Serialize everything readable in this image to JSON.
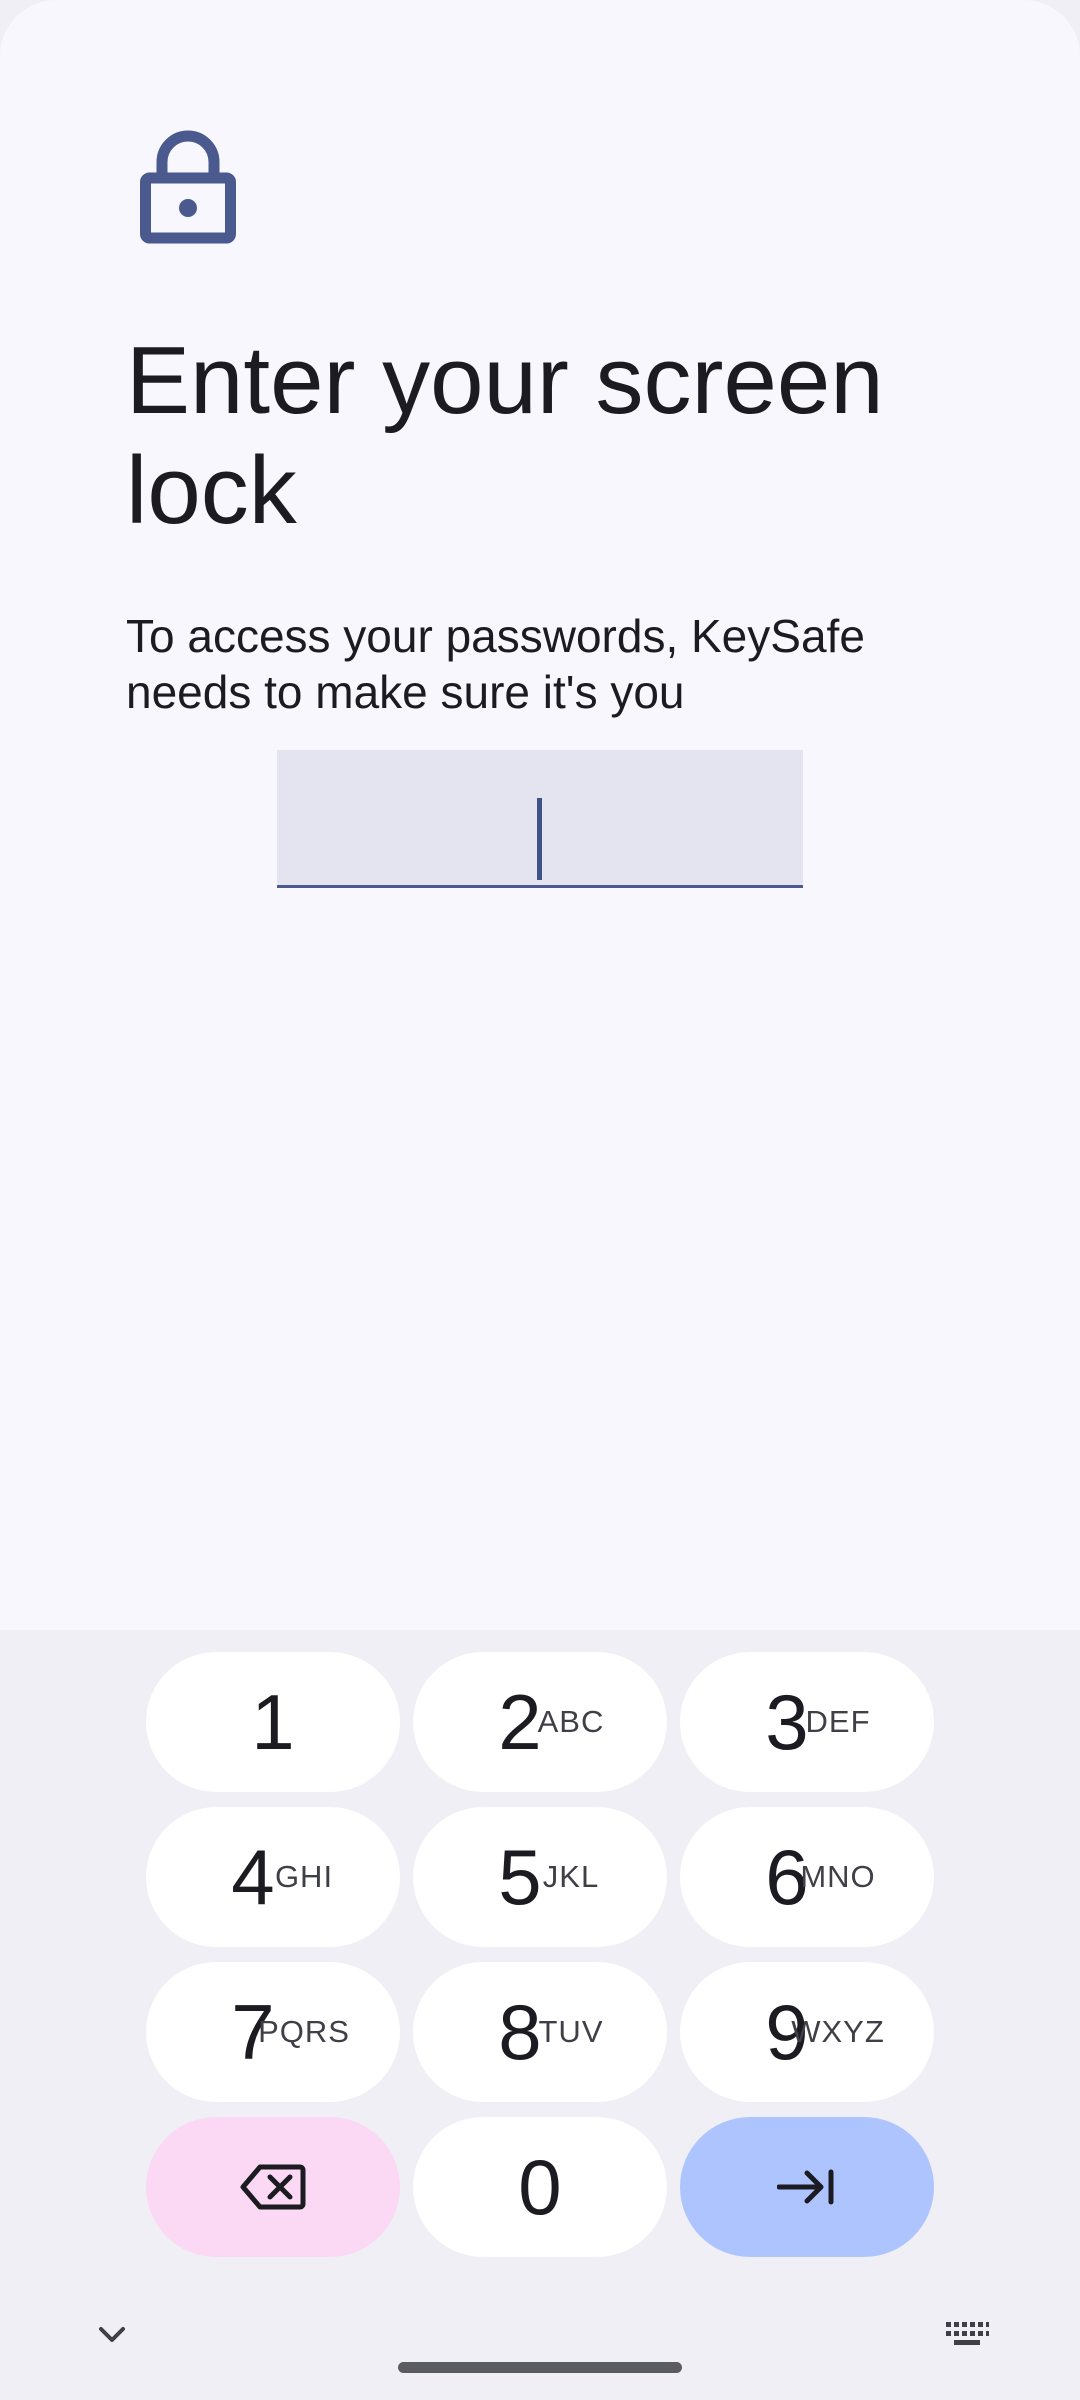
{
  "lock_screen": {
    "icon": "lock-icon",
    "title": "Enter your screen lock",
    "subtitle": "To access your passwords, KeySafe needs to make sure it's you",
    "pin_field_value": ""
  },
  "keypad": {
    "keys": [
      {
        "digit": "1",
        "letters": ""
      },
      {
        "digit": "2",
        "letters": "ABC"
      },
      {
        "digit": "3",
        "letters": "DEF"
      },
      {
        "digit": "4",
        "letters": "GHI"
      },
      {
        "digit": "5",
        "letters": "JKL"
      },
      {
        "digit": "6",
        "letters": "MNO"
      },
      {
        "digit": "7",
        "letters": "PQRS"
      },
      {
        "digit": "8",
        "letters": "TUV"
      },
      {
        "digit": "9",
        "letters": "WXYZ"
      },
      {
        "digit": "0",
        "letters": ""
      }
    ],
    "backspace_icon": "backspace-icon",
    "enter_icon": "tab-enter-icon"
  },
  "navigation": {
    "hide_keyboard_icon": "chevron-down-icon",
    "switch_keyboard_icon": "keyboard-icon"
  },
  "colors": {
    "accent": "#4a5a8e",
    "backspace_key": "#fbd8f4",
    "enter_key": "#adc4ff",
    "sheet_background": "#f8f7fd",
    "keyboard_background": "#f0eff5"
  }
}
